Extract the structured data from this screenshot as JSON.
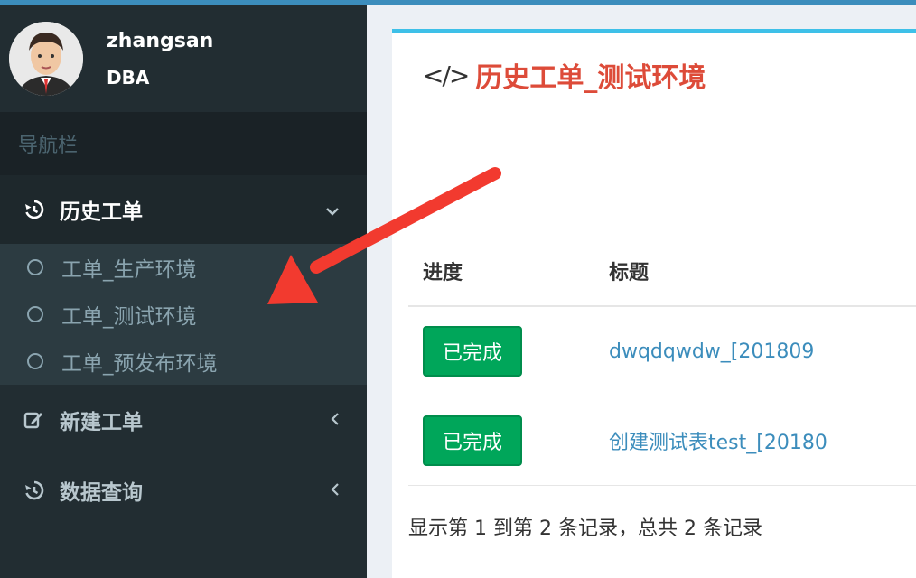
{
  "user": {
    "name": "zhangsan",
    "role": "DBA"
  },
  "sidebar": {
    "header": "导航栏",
    "history": {
      "label": "历史工单",
      "items": [
        {
          "label": "工单_生产环境"
        },
        {
          "label": "工单_测试环境"
        },
        {
          "label": "工单_预发布环境"
        }
      ]
    },
    "create": {
      "label": "新建工单"
    },
    "query": {
      "label": "数据查询"
    }
  },
  "main": {
    "title": "历史工单_测试环境",
    "table": {
      "headers": [
        "进度",
        "标题"
      ],
      "rows": [
        {
          "status": "已完成",
          "title": "dwqdqwdw_[201809"
        },
        {
          "status": "已完成",
          "title": "创建测试表test_[20180"
        }
      ]
    },
    "footer": "显示第 1 到第 2 条记录，总共 2 条记录"
  },
  "colors": {
    "sidebar_bg": "#222d32",
    "accent_top": "#3c8dbc",
    "title_red": "#dd4b39",
    "badge_green": "#00a65a",
    "link_blue": "#3c8dbc",
    "annotation_arrow": "#f23a2f"
  },
  "icons": [
    "history-icon",
    "chevron-down-icon",
    "circle-icon",
    "edit-icon",
    "chevron-left-icon",
    "code-icon",
    "annotation-arrow"
  ]
}
